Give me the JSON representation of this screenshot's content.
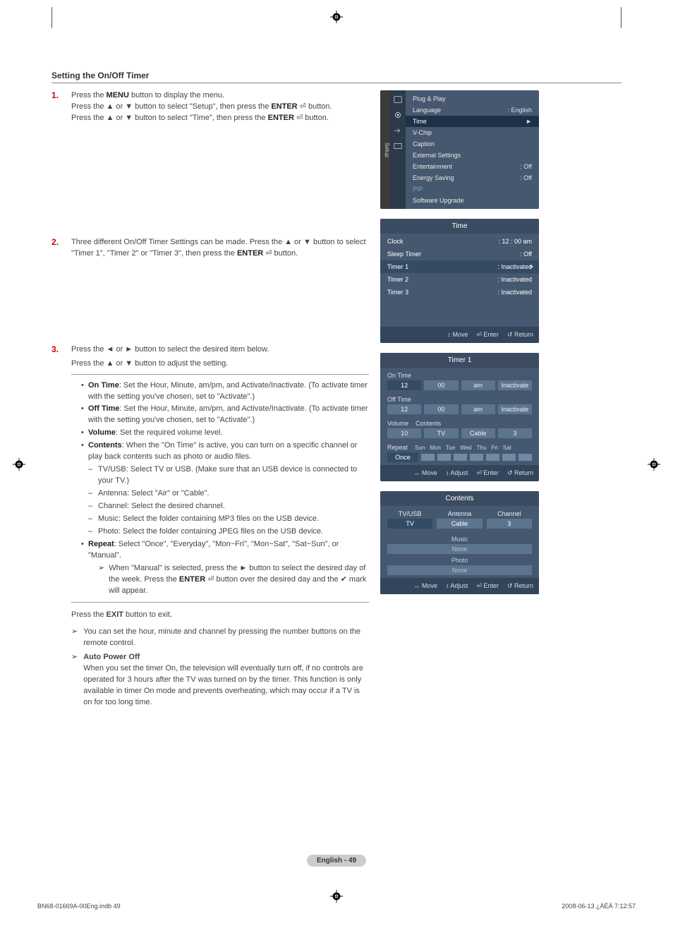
{
  "heading": "Setting the On/Off Timer",
  "steps": {
    "s1": {
      "num": "1.",
      "l1a": "Press the ",
      "l1b": "MENU",
      "l1c": " button to display the menu.",
      "l2a": "Press the ▲ or ▼ button to select \"Setup\", then press the ",
      "l2b": "ENTER",
      "l2c": " ",
      "l2d": " button.",
      "l3a": "Press the ▲ or ▼ button to select \"Time\", then press the ",
      "l3b": "ENTER",
      "l3c": " ",
      "l3d": " button."
    },
    "s2": {
      "num": "2.",
      "t1": "Three different On/Off Timer Settings can be made. Press the ▲ or ▼ button to select \"Timer 1\", \"Timer 2\" or \"Timer 3\", then press the ",
      "t2": "ENTER",
      "t3": " ",
      "t4": " button."
    },
    "s3": {
      "num": "3.",
      "p1": "Press the ◄ or ► button to select the desired item below.",
      "p2": "Press the ▲ or ▼ button to adjust the setting.",
      "b_on_label": "On Time",
      "b_on_text": ": Set the Hour, Minute, am/pm, and Activate/Inactivate. (To activate timer with the setting you've chosen, set to \"Activate\".)",
      "b_off_label": "Off Time",
      "b_off_text": ": Set the Hour, Minute, am/pm, and Activate/Inactivate. (To activate timer with the setting you've chosen, set to \"Activate\".)",
      "b_vol_label": "Volume",
      "b_vol_text": ": Set the required volume level.",
      "b_con_label": "Contents",
      "b_con_text": ": When the \"On Time\" is active, you can turn on a specific channel or play back contents such as photo or audio files.",
      "sub_tvusb": "TV/USB: Select TV or USB. (Make sure that an USB device is connected to your TV.)",
      "sub_ant": "Antenna: Select \"Air\" or \"Cable\".",
      "sub_ch": "Channel: Select the desired channel.",
      "sub_music": "Music: Select the folder containing MP3 files on the USB device.",
      "sub_photo": "Photo: Select the folder containing JPEG files on the USB device.",
      "b_rep_label": "Repeat",
      "b_rep_text": ": Select \"Once\", \"Everyday\", \"Mon~Fri\", \"Mon~Sat\", \"Sat~Sun\", or \"Manual\".",
      "rep_note_a": "When \"Manual\" is selected, press the ► button to select the desired day of the week. Press the ",
      "rep_note_b": "ENTER",
      "rep_note_c": " button over the desired day and the ✔ mark will appear."
    }
  },
  "after": {
    "exit_a": "Press the ",
    "exit_b": "EXIT",
    "exit_c": " button to exit.",
    "note1": "You can set the hour, minute and channel by pressing the number buttons on the remote control.",
    "apo_label": "Auto Power Off",
    "apo_text": "When you set the timer On, the television will eventually turn off, if no controls are operated for 3 hours after the TV was turned on by the timer. This function is only available in timer On mode and prevents overheating, which may occur if a TV is on for too long time."
  },
  "osd1": {
    "side": "Setup",
    "rows": [
      {
        "l": "Plug & Play",
        "v": ""
      },
      {
        "l": "Language",
        "v": ": English"
      },
      {
        "l": "Time",
        "v": "►",
        "sel": true
      },
      {
        "l": "V-Chip",
        "v": ""
      },
      {
        "l": "Caption",
        "v": ""
      },
      {
        "l": "External Settings",
        "v": ""
      },
      {
        "l": "Entertainment",
        "v": ": Off"
      },
      {
        "l": "Energy Saving",
        "v": ": Off"
      },
      {
        "l": "PIP",
        "v": "",
        "dim": true
      },
      {
        "l": "Software Upgrade",
        "v": ""
      }
    ]
  },
  "osd2": {
    "title": "Time",
    "rows": [
      {
        "l": "Clock",
        "v": ": 12 : 00  am"
      },
      {
        "l": "Sleep Timer",
        "v": ": Off"
      },
      {
        "l": "Timer 1",
        "v": ": Inactivated",
        "sel": true
      },
      {
        "l": "Timer 2",
        "v": ": Inactivated"
      },
      {
        "l": "Timer 3",
        "v": ": Inactivated"
      }
    ],
    "hints": {
      "a": "↕ Move",
      "b": "⏎ Enter",
      "c": "↺ Return"
    }
  },
  "osd3": {
    "title": "Timer 1",
    "on_label": "On Time",
    "on_vals": [
      "12",
      "00",
      "am",
      "Inactivate"
    ],
    "off_label": "Off Time",
    "off_vals": [
      "12",
      "00",
      "am",
      "Inactivate"
    ],
    "vol_label": "Volume",
    "con_label": "Contents",
    "volcon_vals": [
      "10",
      "TV",
      "Cable",
      "3"
    ],
    "rep_label": "Repeat",
    "days": [
      "Sun",
      "Mon",
      "Tue",
      "Wed",
      "Thu",
      "Fri",
      "Sat"
    ],
    "rep_val": "Once",
    "hints": {
      "a": "↔ Move",
      "b": "↕ Adjust",
      "c": "⏎ Enter",
      "d": "↺ Return"
    }
  },
  "osd4": {
    "title": "Contents",
    "cols": [
      {
        "lab": "TV/USB",
        "val": "TV",
        "sel": true
      },
      {
        "lab": "Antenna",
        "val": "Cable"
      },
      {
        "lab": "Channel",
        "val": "3"
      }
    ],
    "music_lab": "Music",
    "music_val": "None",
    "photo_lab": "Photo",
    "photo_val": "None",
    "hints": {
      "a": "↔ Move",
      "b": "↕ Adjust",
      "c": "⏎ Enter",
      "d": "↺ Return"
    }
  },
  "page_foot": "English - 49",
  "doc_footer_left": "BN68-01669A-00Eng.indb   49",
  "doc_footer_right": "2008-06-13   ¿ÀÈÄ 7:12:57"
}
